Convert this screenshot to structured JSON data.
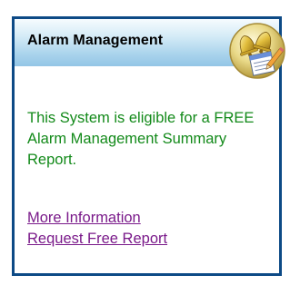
{
  "widget": {
    "title": "Alarm Management",
    "message": "This System is eligible for a FREE Alarm Management Summary Report.",
    "links": {
      "more_info": "More Information",
      "request_report": "Request Free Report"
    },
    "icon": "bell-report-icon",
    "colors": {
      "border": "#0d4a86",
      "header_gradient": "#a9d3ec",
      "message_text": "#138a1a",
      "link_text": "#7a1a8a"
    }
  }
}
